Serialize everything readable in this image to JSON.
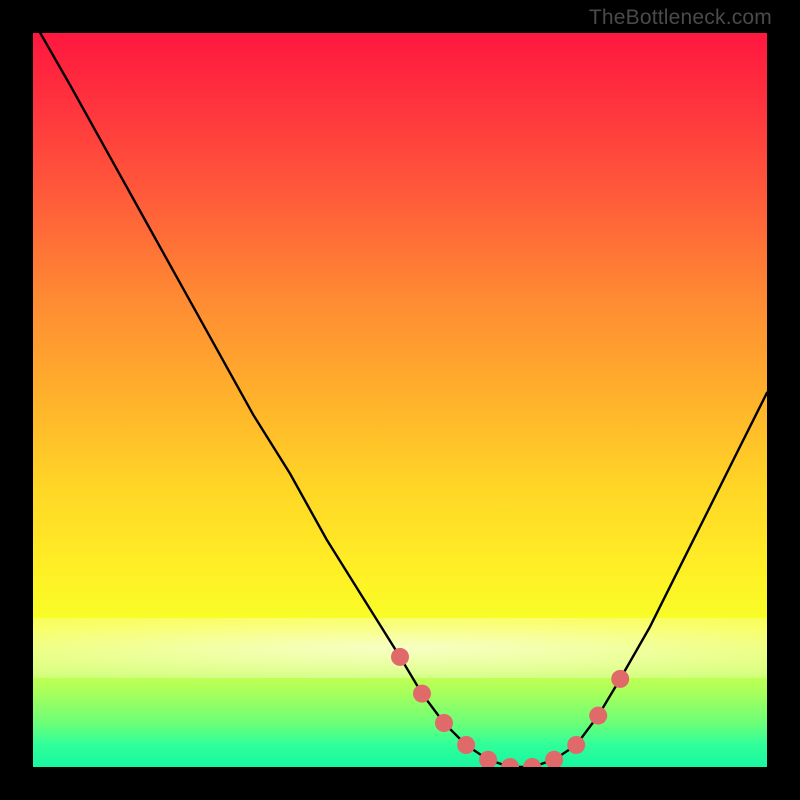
{
  "watermark": "TheBottleneck.com",
  "colors": {
    "background": "#000000",
    "gradient_top": "#ff173f",
    "gradient_mid": "#ffd626",
    "gradient_bottom": "#18f7a0",
    "curve_stroke": "#000000",
    "dot_fill": "#e06a6a"
  },
  "chart_data": {
    "type": "line",
    "title": "",
    "xlabel": "",
    "ylabel": "",
    "xlim": [
      0,
      100
    ],
    "ylim": [
      0,
      100
    ],
    "grid": false,
    "series": [
      {
        "name": "bottleneck-curve",
        "x": [
          1,
          5,
          10,
          15,
          20,
          25,
          30,
          35,
          40,
          45,
          50,
          53,
          56,
          59,
          62,
          65,
          68,
          71,
          74,
          77,
          80,
          84,
          88,
          92,
          96,
          100
        ],
        "y": [
          100,
          93,
          84,
          75,
          66,
          57,
          48,
          40,
          31,
          23,
          15,
          10,
          6,
          3,
          1,
          0,
          0,
          1,
          3,
          7,
          12,
          19,
          27,
          35,
          43,
          51
        ]
      }
    ],
    "markers": {
      "name": "highlighted-points",
      "x": [
        50,
        53,
        56,
        59,
        62,
        65,
        68,
        71,
        74,
        77,
        80
      ],
      "y": [
        15,
        10,
        6,
        3,
        1,
        0,
        0,
        1,
        3,
        7,
        12
      ]
    },
    "annotations": []
  }
}
